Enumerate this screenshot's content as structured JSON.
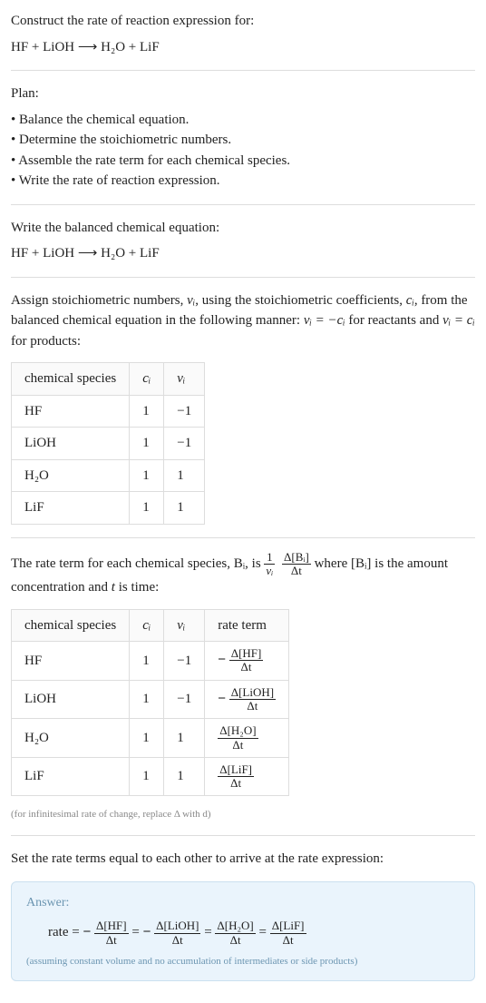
{
  "intro": {
    "prompt": "Construct the rate of reaction expression for:",
    "equation_plain": "HF + LiOH ⟶ H₂O + LiF"
  },
  "plan": {
    "heading": "Plan:",
    "items": [
      "Balance the chemical equation.",
      "Determine the stoichiometric numbers.",
      "Assemble the rate term for each chemical species.",
      "Write the rate of reaction expression."
    ]
  },
  "balanced": {
    "lead": "Write the balanced chemical equation:",
    "equation_plain": "HF + LiOH ⟶ H₂O + LiF"
  },
  "stoich": {
    "lead_before": "Assign stoichiometric numbers, ",
    "nu_i": "νᵢ",
    "lead_mid1": ", using the stoichiometric coefficients, ",
    "c_i": "cᵢ",
    "lead_mid2": ", from the balanced chemical equation in the following manner: ",
    "manner_reactants": "νᵢ = −cᵢ",
    "manner_mid": " for reactants and ",
    "manner_products": "νᵢ = cᵢ",
    "manner_end": " for products:",
    "headers": {
      "species": "chemical species",
      "c": "cᵢ",
      "nu": "νᵢ"
    },
    "rows": [
      {
        "species": "HF",
        "c": "1",
        "nu": "−1"
      },
      {
        "species": "LiOH",
        "c": "1",
        "nu": "−1"
      },
      {
        "species": "H₂O",
        "c": "1",
        "nu": "1"
      },
      {
        "species": "LiF",
        "c": "1",
        "nu": "1"
      }
    ]
  },
  "rate_term_intro": {
    "t1": "The rate term for each chemical species, Bᵢ, is ",
    "frac1_num": "1",
    "frac1_den": "νᵢ",
    "frac2_num": "Δ[Bᵢ]",
    "frac2_den": "Δt",
    "t2": " where [Bᵢ] is the amount concentration and ",
    "t_var": "t",
    "t3": " is time:"
  },
  "rate_table": {
    "headers": {
      "species": "chemical species",
      "c": "cᵢ",
      "nu": "νᵢ",
      "term": "rate term"
    },
    "rows": [
      {
        "species": "HF",
        "c": "1",
        "nu": "−1",
        "sign": "−",
        "num": "Δ[HF]",
        "den": "Δt"
      },
      {
        "species": "LiOH",
        "c": "1",
        "nu": "−1",
        "sign": "−",
        "num": "Δ[LiOH]",
        "den": "Δt"
      },
      {
        "species": "H₂O",
        "c": "1",
        "nu": "1",
        "sign": "",
        "num": "Δ[H₂O]",
        "den": "Δt"
      },
      {
        "species": "LiF",
        "c": "1",
        "nu": "1",
        "sign": "",
        "num": "Δ[LiF]",
        "den": "Δt"
      }
    ],
    "note": "(for infinitesimal rate of change, replace Δ with d)"
  },
  "final": {
    "lead": "Set the rate terms equal to each other to arrive at the rate expression:",
    "answer_heading": "Answer:",
    "rate_label": "rate = ",
    "eq": " = ",
    "terms": [
      {
        "sign": "−",
        "num": "Δ[HF]",
        "den": "Δt"
      },
      {
        "sign": "−",
        "num": "Δ[LiOH]",
        "den": "Δt"
      },
      {
        "sign": "",
        "num": "Δ[H₂O]",
        "den": "Δt"
      },
      {
        "sign": "",
        "num": "Δ[LiF]",
        "den": "Δt"
      }
    ],
    "assuming": "(assuming constant volume and no accumulation of intermediates or side products)"
  }
}
